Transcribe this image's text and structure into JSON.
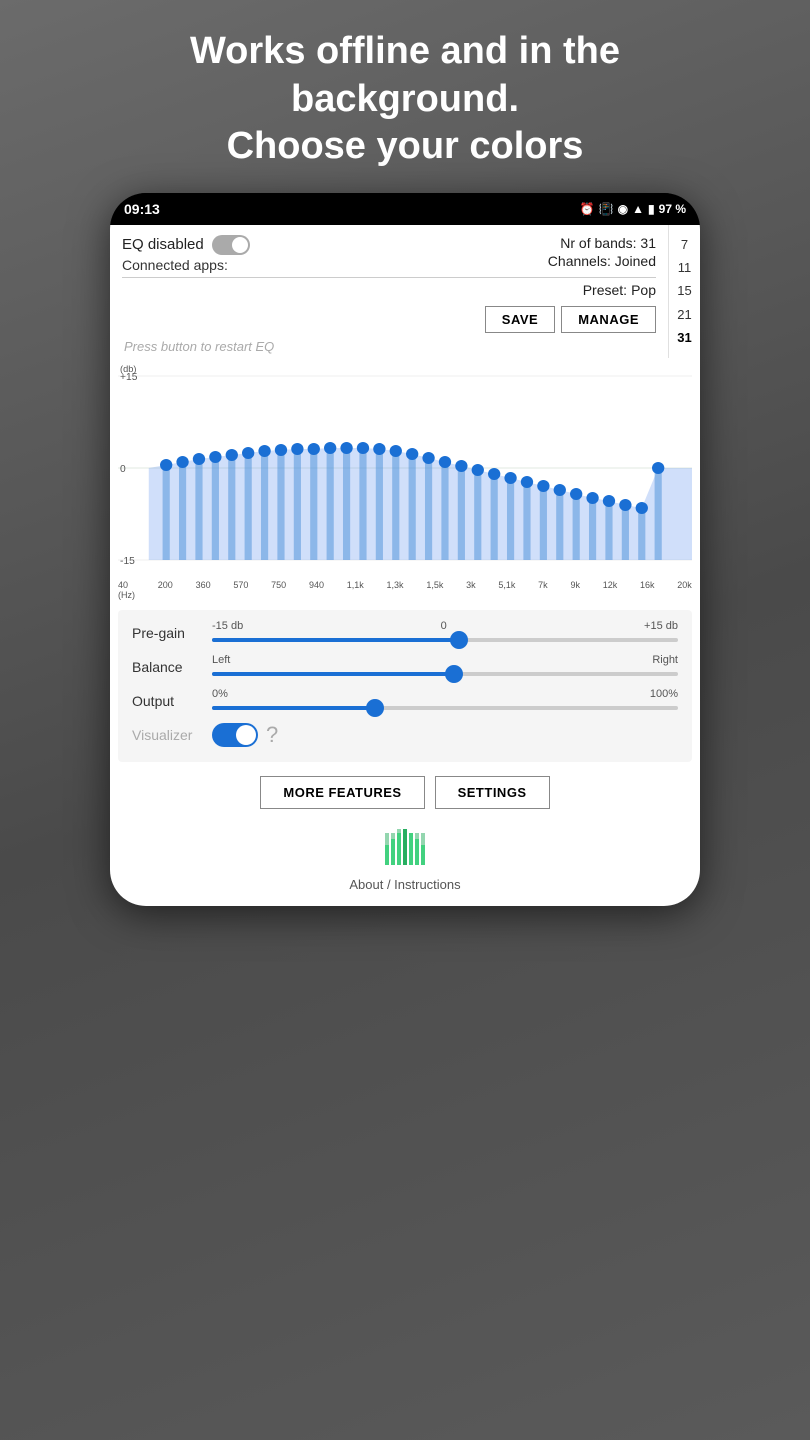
{
  "headline": {
    "line1": "Works offline and in the",
    "line2": "background.",
    "line3": "Choose your colors"
  },
  "status_bar": {
    "time": "09:13",
    "battery": "97 %",
    "icons": "⏰ 📳 ◉ ▲ 🔋"
  },
  "eq": {
    "disabled_label": "EQ disabled",
    "connected_apps_label": "Connected apps:",
    "nr_bands_label": "Nr of bands:",
    "nr_bands_value": "31",
    "channels_label": "Channels:",
    "channels_value": "Joined",
    "preset_label": "Preset:",
    "preset_value": "Pop",
    "save_label": "SAVE",
    "manage_label": "MANAGE",
    "restart_text": "Press button to restart EQ",
    "db_top": "+15",
    "db_unit": "(db)",
    "db_bottom": "-15",
    "freq_labels": [
      "40\n(Hz)",
      "200",
      "360",
      "570",
      "750",
      "940",
      "1,1k",
      "1,3k",
      "1,5k",
      "3k",
      "5,1k",
      "7k",
      "9k",
      "12k",
      "16k",
      "20k"
    ]
  },
  "bands_selector": {
    "options": [
      "7",
      "11",
      "15",
      "21",
      "31"
    ],
    "selected": "31"
  },
  "sliders": {
    "pregain": {
      "label": "Pre-gain",
      "min": "-15 db",
      "max": "+15 db",
      "center": "0",
      "value_pct": 53
    },
    "balance": {
      "label": "Balance",
      "min": "Left",
      "max": "Right",
      "value_pct": 52
    },
    "output": {
      "label": "Output",
      "min": "0%",
      "max": "100%",
      "value_pct": 35
    }
  },
  "visualizer": {
    "label": "Visualizer",
    "enabled": true
  },
  "buttons": {
    "more_features": "MORE FEATURES",
    "settings": "SETTINGS"
  },
  "about": {
    "text": "About / Instructions"
  }
}
